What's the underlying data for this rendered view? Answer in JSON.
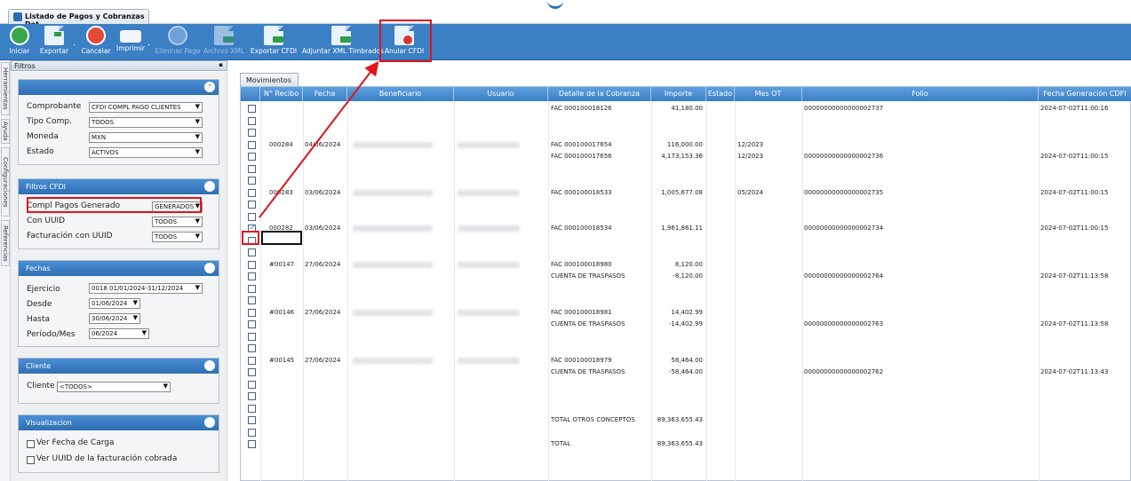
{
  "window": {
    "tab_title": "Listado de Pagos y Cobranzas Det..."
  },
  "toolbar": {
    "buttons": [
      {
        "label": "Iniciar",
        "enabled": true,
        "icon": "play-icon"
      },
      {
        "label": "Exportar",
        "enabled": true,
        "icon": "export-icon"
      },
      {
        "label": "Cancelar",
        "enabled": true,
        "icon": "cancel-icon"
      },
      {
        "label": "Imprimir",
        "enabled": true,
        "icon": "printer-icon"
      },
      {
        "label": "Eliminar Pago",
        "enabled": false,
        "icon": "delete-payment-icon"
      },
      {
        "label": "Archivo XML",
        "enabled": false,
        "icon": "xml-file-icon"
      },
      {
        "label": "Exportar CFDI",
        "enabled": true,
        "icon": "export-cfdi-icon"
      },
      {
        "label": "Adjuntar XML Timbrados",
        "enabled": true,
        "icon": "attach-xml-icon"
      },
      {
        "label": "Anular CFDI",
        "enabled": true,
        "icon": "cancel-cfdi-icon"
      }
    ]
  },
  "side_tabs": [
    "Herramientas",
    "Ayuda",
    "Configuraciones",
    "Referencias"
  ],
  "filters_panel": {
    "title": "Filtros",
    "general": {
      "comprobante_label": "Comprobante",
      "comprobante_value": "CFDI COMPL PAGO CLIENTES",
      "tipo_label": "Tipo Comp.",
      "tipo_value": "TODOS",
      "moneda_label": "Moneda",
      "moneda_value": "MXN",
      "estado_label": "Estado",
      "estado_value": "ACTIVOS"
    },
    "cfdi": {
      "title": "Filtros CFDI",
      "compl_label": "Compl Pagos Generado",
      "compl_value": "GENERADOS",
      "uuid_label": "Con UUID",
      "uuid_value": "TODOS",
      "fact_label": "Facturación con UUID",
      "fact_value": "TODOS"
    },
    "fechas": {
      "title": "Fechas",
      "ejercicio_label": "Ejercicio",
      "ejercicio_value": "0018 01/01/2024-31/12/2024",
      "desde_label": "Desde",
      "desde_value": "01/06/2024",
      "hasta_label": "Hasta",
      "hasta_value": "30/06/2024",
      "periodo_label": "Período/Mes",
      "periodo_value": "06/2024"
    },
    "cliente": {
      "title": "Cliente",
      "label": "Cliente",
      "value": "<TODOS>"
    },
    "visualizacion": {
      "title": "Visualizacion",
      "opt1": "Ver Fecha de Carga",
      "opt2": "Ver UUID de la facturación cobrada"
    }
  },
  "grid": {
    "tab": "Movimientos",
    "columns": [
      "N° Recibo",
      "Fecha",
      "Beneficiario",
      "Usuario",
      "Detalle de la Cobranza",
      "Importe",
      "Estado",
      "Mes OT",
      "Folio",
      "Fecha Generación CDFI"
    ],
    "rows": [
      {
        "recibo": "",
        "fecha": "",
        "detalle": "FAC 000100018126",
        "importe": "41,180.00",
        "mes": "",
        "folio": "00000000000000002737",
        "fgen": "2024-07-02T11:00:16",
        "checked": false
      },
      {
        "recibo": "",
        "fecha": "",
        "detalle": "",
        "importe": "",
        "mes": "",
        "folio": "",
        "fgen": "",
        "checked": false
      },
      {
        "recibo": "",
        "fecha": "",
        "detalle": "",
        "importe": "",
        "mes": "",
        "folio": "",
        "fgen": "",
        "checked": false
      },
      {
        "recibo": "000284",
        "fecha": "04/06/2024",
        "detalle": "FAC 000100017654",
        "importe": "116,000.00",
        "mes": "12/2023",
        "folio": "",
        "fgen": "",
        "checked": false
      },
      {
        "recibo": "",
        "fecha": "",
        "detalle": "FAC 000100017656",
        "importe": "4,173,153.36",
        "mes": "12/2023",
        "folio": "00000000000000002736",
        "fgen": "2024-07-02T11:00:15",
        "checked": false
      },
      {
        "recibo": "",
        "fecha": "",
        "detalle": "",
        "importe": "",
        "mes": "",
        "folio": "",
        "fgen": "",
        "checked": false
      },
      {
        "recibo": "",
        "fecha": "",
        "detalle": "",
        "importe": "",
        "mes": "",
        "folio": "",
        "fgen": "",
        "checked": false
      },
      {
        "recibo": "000283",
        "fecha": "03/06/2024",
        "detalle": "FAC 000100018533",
        "importe": "1,005,677.08",
        "mes": "05/2024",
        "folio": "00000000000000002735",
        "fgen": "2024-07-02T11:00:15",
        "checked": false
      },
      {
        "recibo": "",
        "fecha": "",
        "detalle": "",
        "importe": "",
        "mes": "",
        "folio": "",
        "fgen": "",
        "checked": false
      },
      {
        "recibo": "",
        "fecha": "",
        "detalle": "",
        "importe": "",
        "mes": "",
        "folio": "",
        "fgen": "",
        "checked": false
      },
      {
        "recibo": "000282",
        "fecha": "03/06/2024",
        "detalle": "FAC 000100018534",
        "importe": "1,961,861.11",
        "mes": "",
        "folio": "00000000000000002734",
        "fgen": "2024-07-02T11:00:15",
        "checked": true
      },
      {
        "recibo": "",
        "fecha": "",
        "detalle": "",
        "importe": "",
        "mes": "",
        "folio": "",
        "fgen": "",
        "checked": false
      },
      {
        "recibo": "",
        "fecha": "",
        "detalle": "",
        "importe": "",
        "mes": "",
        "folio": "",
        "fgen": "",
        "checked": false
      },
      {
        "recibo": "#00147",
        "fecha": "27/06/2024",
        "detalle": "FAC 000100018980",
        "importe": "8,120.00",
        "mes": "",
        "folio": "",
        "fgen": "",
        "checked": false
      },
      {
        "recibo": "",
        "fecha": "",
        "detalle": "CUENTA DE TRASPASOS",
        "importe": "-8,120.00",
        "mes": "",
        "folio": "00000000000000002764",
        "fgen": "2024-07-02T11:13:58",
        "checked": false
      },
      {
        "recibo": "",
        "fecha": "",
        "detalle": "",
        "importe": "",
        "mes": "",
        "folio": "",
        "fgen": "",
        "checked": false
      },
      {
        "recibo": "",
        "fecha": "",
        "detalle": "",
        "importe": "",
        "mes": "",
        "folio": "",
        "fgen": "",
        "checked": false
      },
      {
        "recibo": "#00146",
        "fecha": "27/06/2024",
        "detalle": "FAC 000100018981",
        "importe": "14,402.99",
        "mes": "",
        "folio": "",
        "fgen": "",
        "checked": false
      },
      {
        "recibo": "",
        "fecha": "",
        "detalle": "CUENTA DE TRASPASOS",
        "importe": "-14,402.99",
        "mes": "",
        "folio": "00000000000000002763",
        "fgen": "2024-07-02T11:13:58",
        "checked": false
      },
      {
        "recibo": "",
        "fecha": "",
        "detalle": "",
        "importe": "",
        "mes": "",
        "folio": "",
        "fgen": "",
        "checked": false
      },
      {
        "recibo": "",
        "fecha": "",
        "detalle": "",
        "importe": "",
        "mes": "",
        "folio": "",
        "fgen": "",
        "checked": false
      },
      {
        "recibo": "#00145",
        "fecha": "27/06/2024",
        "detalle": "FAC 000100018979",
        "importe": "58,464.00",
        "mes": "",
        "folio": "",
        "fgen": "",
        "checked": false
      },
      {
        "recibo": "",
        "fecha": "",
        "detalle": "CUENTA DE TRASPASOS",
        "importe": "-58,464.00",
        "mes": "",
        "folio": "00000000000000002762",
        "fgen": "2024-07-02T11:13:43",
        "checked": false
      },
      {
        "recibo": "",
        "fecha": "",
        "detalle": "",
        "importe": "",
        "mes": "",
        "folio": "",
        "fgen": "",
        "checked": false
      },
      {
        "recibo": "",
        "fecha": "",
        "detalle": "",
        "importe": "",
        "mes": "",
        "folio": "",
        "fgen": "",
        "checked": false
      },
      {
        "recibo": "",
        "fecha": "",
        "detalle": "",
        "importe": "",
        "mes": "",
        "folio": "",
        "fgen": "",
        "checked": false
      },
      {
        "recibo": "",
        "fecha": "",
        "detalle": "TOTAL OTROS CONCEPTOS",
        "importe": "89,363,655.43",
        "mes": "",
        "folio": "",
        "fgen": "",
        "checked": false
      },
      {
        "recibo": "",
        "fecha": "",
        "detalle": "",
        "importe": "",
        "mes": "",
        "folio": "",
        "fgen": "",
        "checked": false
      },
      {
        "recibo": "",
        "fecha": "",
        "detalle": "TOTAL",
        "importe": "89,363,655.43",
        "mes": "",
        "folio": "",
        "fgen": "",
        "checked": false
      }
    ]
  },
  "colors": {
    "toolbar": "#3b7fc4",
    "header": "#3b7fc4",
    "highlight": "#e0141b"
  }
}
